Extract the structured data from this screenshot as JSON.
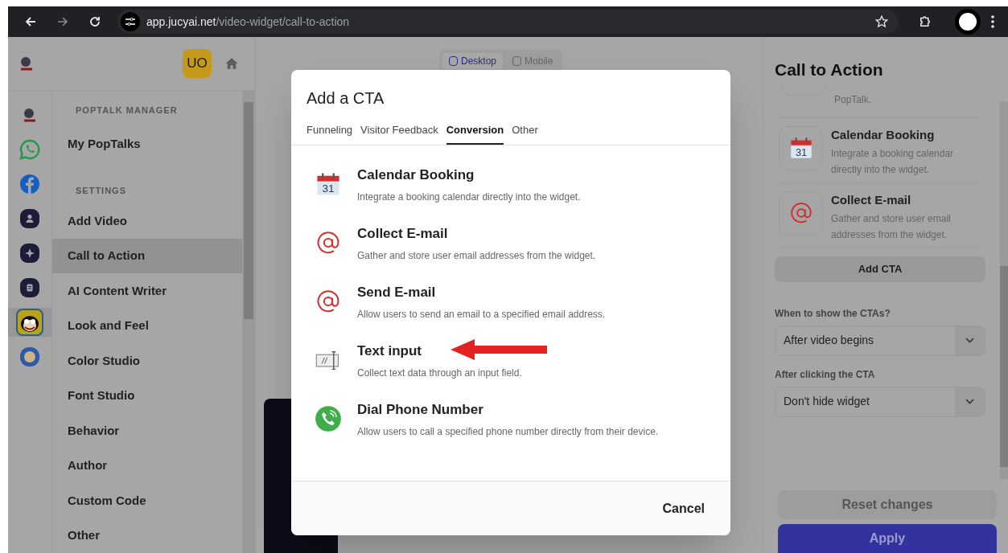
{
  "browser": {
    "url_host": "app.jucyai.net",
    "url_path": "/video-widget/call-to-action"
  },
  "app_header": {
    "avatar_initials": "UO"
  },
  "icon_rail": [
    {
      "kind": "logo",
      "selected": false
    },
    {
      "kind": "whatsapp",
      "selected": false
    },
    {
      "kind": "facebook",
      "selected": false
    },
    {
      "kind": "person",
      "selected": false
    },
    {
      "kind": "sparkle",
      "selected": false
    },
    {
      "kind": "document",
      "selected": false
    },
    {
      "kind": "cartoon",
      "selected": true
    },
    {
      "kind": "dollar",
      "selected": false
    }
  ],
  "nav": [
    {
      "heading": "POPTALK MANAGER",
      "items": [
        {
          "label": "My PopTalks",
          "selected": false
        }
      ]
    },
    {
      "heading": "SETTINGS",
      "items": [
        {
          "label": "Add Video",
          "selected": false
        },
        {
          "label": "Call to Action",
          "selected": true
        },
        {
          "label": "AI Content Writer",
          "selected": false
        },
        {
          "label": "Look and Feel",
          "selected": false
        },
        {
          "label": "Color Studio",
          "selected": false
        },
        {
          "label": "Font Studio",
          "selected": false
        },
        {
          "label": "Behavior",
          "selected": false
        },
        {
          "label": "Author",
          "selected": false
        },
        {
          "label": "Custom Code",
          "selected": false
        },
        {
          "label": "Other",
          "selected": false
        }
      ]
    }
  ],
  "preview_toggle": [
    {
      "label": "Desktop",
      "selected": true
    },
    {
      "label": "Mobile",
      "selected": false
    }
  ],
  "modal": {
    "title": "Add a CTA",
    "tabs": [
      {
        "label": "Funneling",
        "selected": false
      },
      {
        "label": "Visitor Feedback",
        "selected": false
      },
      {
        "label": "Conversion",
        "selected": true
      },
      {
        "label": "Other",
        "selected": false
      }
    ],
    "options": [
      {
        "kind": "calendar",
        "icon_text": "31",
        "title": "Calendar Booking",
        "description": "Integrate a booking calendar directly into the widget.",
        "annotated": false
      },
      {
        "kind": "at",
        "title": "Collect E-mail",
        "description": "Gather and store user email addresses from the widget.",
        "annotated": false
      },
      {
        "kind": "at",
        "title": "Send E-mail",
        "description": "Allow users to send an email to a specified email address.",
        "annotated": false
      },
      {
        "kind": "text_input",
        "title": "Text input",
        "description": "Collect text data through an input field.",
        "annotated": true
      },
      {
        "kind": "phone",
        "title": "Dial Phone Number",
        "description": "Allow users to call a specified phone number directly from their device.",
        "annotated": false
      }
    ],
    "cancel": "Cancel"
  },
  "right_panel": {
    "title": "Call to Action",
    "partial_card_text": "PopTalk.",
    "cards": [
      {
        "kind": "calendar",
        "icon_text": "31",
        "title": "Calendar Booking",
        "description": "Integrate a booking calendar directly into the widget."
      },
      {
        "kind": "at",
        "title": "Collect E-mail",
        "description": "Gather and store user email addresses from the widget."
      }
    ],
    "add_button": "Add CTA",
    "fields": [
      {
        "label": "When to show the CTAs?",
        "value": "After video begins"
      },
      {
        "label": "After clicking the CTA",
        "value": "Don't hide widget"
      }
    ],
    "reset_button": "Reset changes",
    "apply_button": "Apply"
  }
}
